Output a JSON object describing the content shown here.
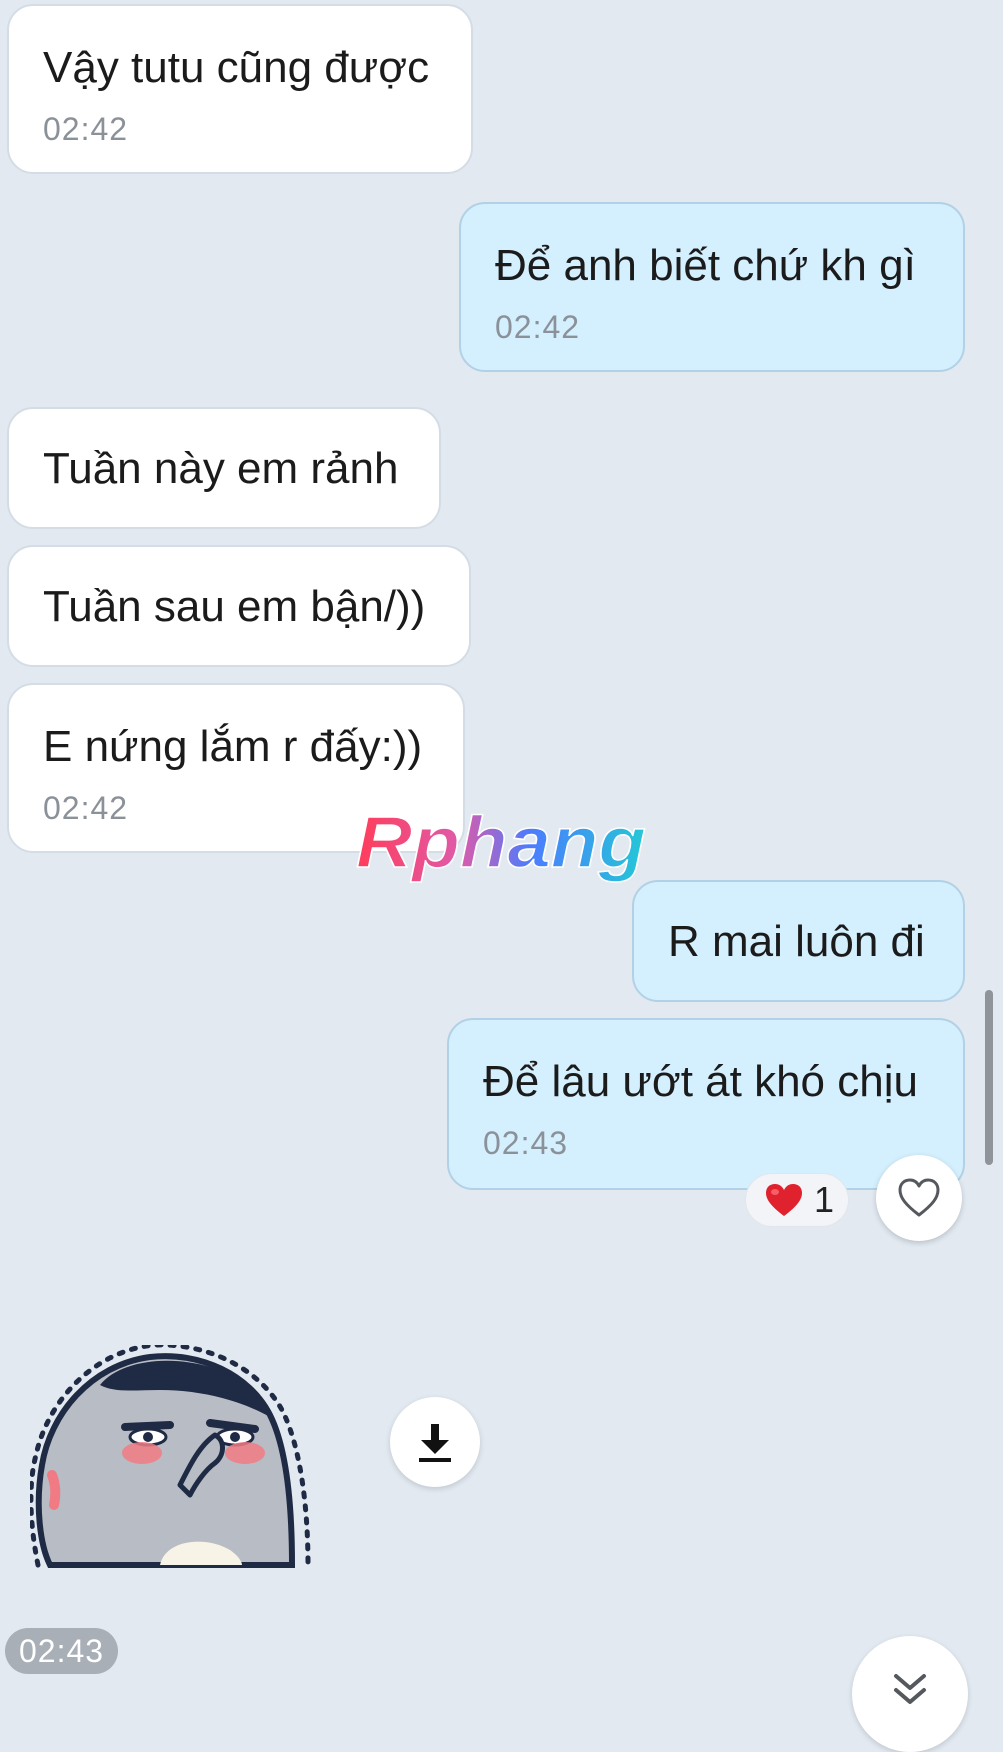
{
  "messages": [
    {
      "side": "in",
      "text": "Vậy tutu cũng được",
      "time": "02:42"
    },
    {
      "side": "out",
      "text": "Để anh biết chứ kh gì",
      "time": "02:42"
    },
    {
      "side": "in",
      "text": "Tuần này em rảnh"
    },
    {
      "side": "in",
      "text": "Tuần sau em bận/))"
    },
    {
      "side": "in",
      "text": "E nứng lắm r đấy:))",
      "time": "02:42"
    },
    {
      "side": "out",
      "text": "R mai luôn đi"
    },
    {
      "side": "out",
      "text": "Để lâu ướt át khó chịu",
      "time": "02:43"
    }
  ],
  "watermark": "Rphang",
  "reaction": {
    "emoji_icon": "red-heart-icon",
    "count": "1",
    "color": "#e0212e"
  },
  "like_icon": "heart-outline-icon",
  "sticker": {
    "time": "02:43",
    "download_icon": "download-icon"
  },
  "scroll_down_icon": "chevron-double-down-icon",
  "colors": {
    "background": "#e2e9f1",
    "incoming_bubble": "#ffffff",
    "outgoing_bubble": "#d4effd",
    "time_text": "#8b9198"
  }
}
